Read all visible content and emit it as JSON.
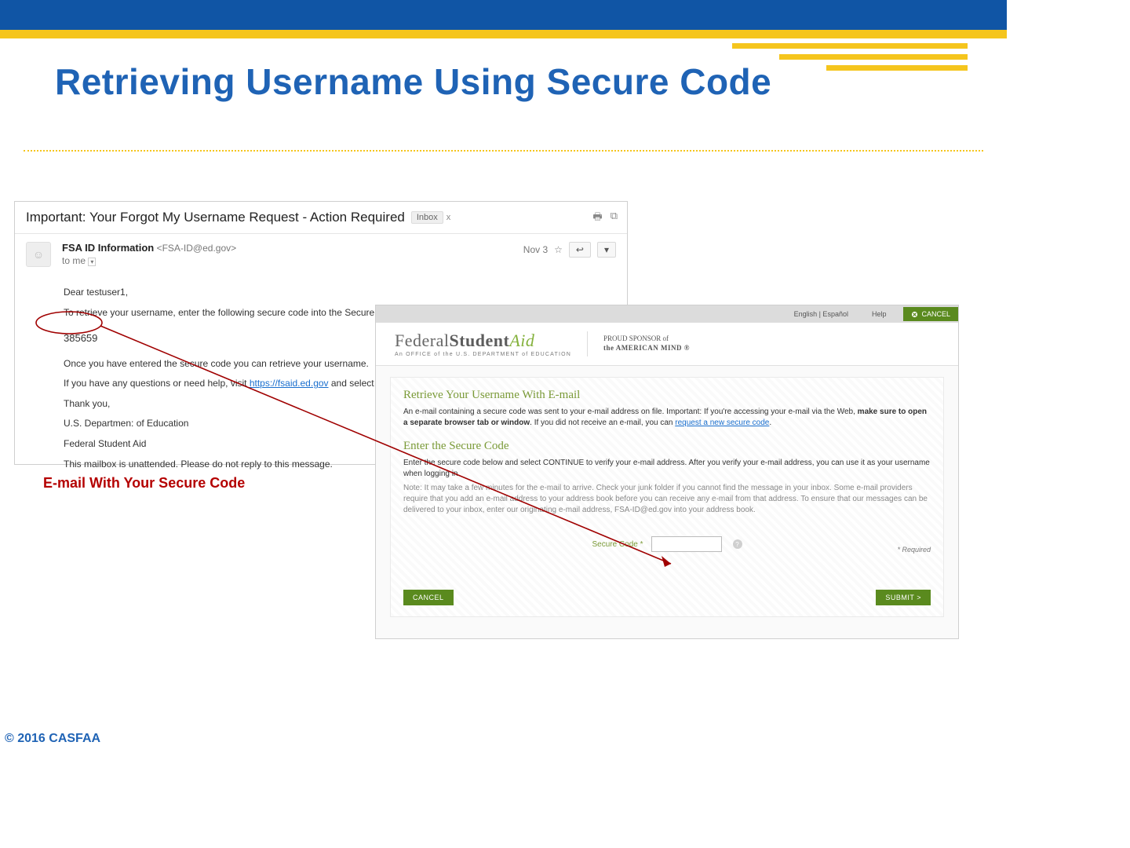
{
  "slide": {
    "title": "Retrieving Username Using Secure Code",
    "footer": "© 2016 CASFAA"
  },
  "email": {
    "subject": "Important: Your Forgot My Username Request - Action Required",
    "inbox_tag": "Inbox",
    "from_name": "FSA ID Information",
    "from_addr": "<FSA-ID@ed.gov>",
    "to_line": "to me",
    "date": "Nov 3",
    "body": {
      "greeting": "Dear testuser1,",
      "line1": "To retrieve your username, enter the following secure code into the Secure Code fie",
      "secure_code": "385659",
      "line2": "Once you have entered the secure code you can retrieve your username.",
      "line3a": "If you have any questions or need help, visit ",
      "help_link": "https://fsaid.ed.gov",
      "line3b": " and select Help for",
      "thankyou": "Thank you,",
      "dept": "U.S. Departmen: of Education",
      "fsa": "Federal Student Aid",
      "noreply": "This mailbox is unattended. Please do not reply to this message."
    },
    "caption": "E-mail With Your Secure Code"
  },
  "fsa": {
    "topbar": {
      "lang": "English | Español",
      "help": "Help",
      "cancel": "CANCEL"
    },
    "brand": {
      "fed": "Federal",
      "stu": "Student",
      "aid": "Aid",
      "sub": "An OFFICE of the U.S. DEPARTMENT of EDUCATION",
      "sponsor1": "PROUD SPONSOR of",
      "sponsor2": "the AMERICAN MIND ®"
    },
    "section1_title": "Retrieve Your Username With E-mail",
    "section1_p_a": "An e-mail containing a secure code was sent to your e-mail address on file. Important: If you're accessing your e-mail via the Web, ",
    "section1_bold": "make sure to open a separate browser tab or window",
    "section1_p_b": ". If you did not receive an e-mail, you can ",
    "section1_link": "request a new secure code",
    "section2_title": "Enter the Secure Code",
    "section2_p1": "Enter the secure code below and select CONTINUE to verify your e-mail address. After you verify your e-mail address, you can use it as your username when logging in.",
    "section2_p2": "Note: It may take a few minutes for the e-mail to arrive. Check your junk folder if you cannot find the message in your inbox. Some e-mail providers require that you add an e-mail address to your address book before you can receive any e-mail from that address. To ensure that our messages can be delivered to your inbox, enter our originating e-mail address, FSA-ID@ed.gov into your address book.",
    "field_label": "Secure Code *",
    "required": "* Required",
    "btn_cancel": "CANCEL",
    "btn_submit": "SUBMIT >"
  }
}
